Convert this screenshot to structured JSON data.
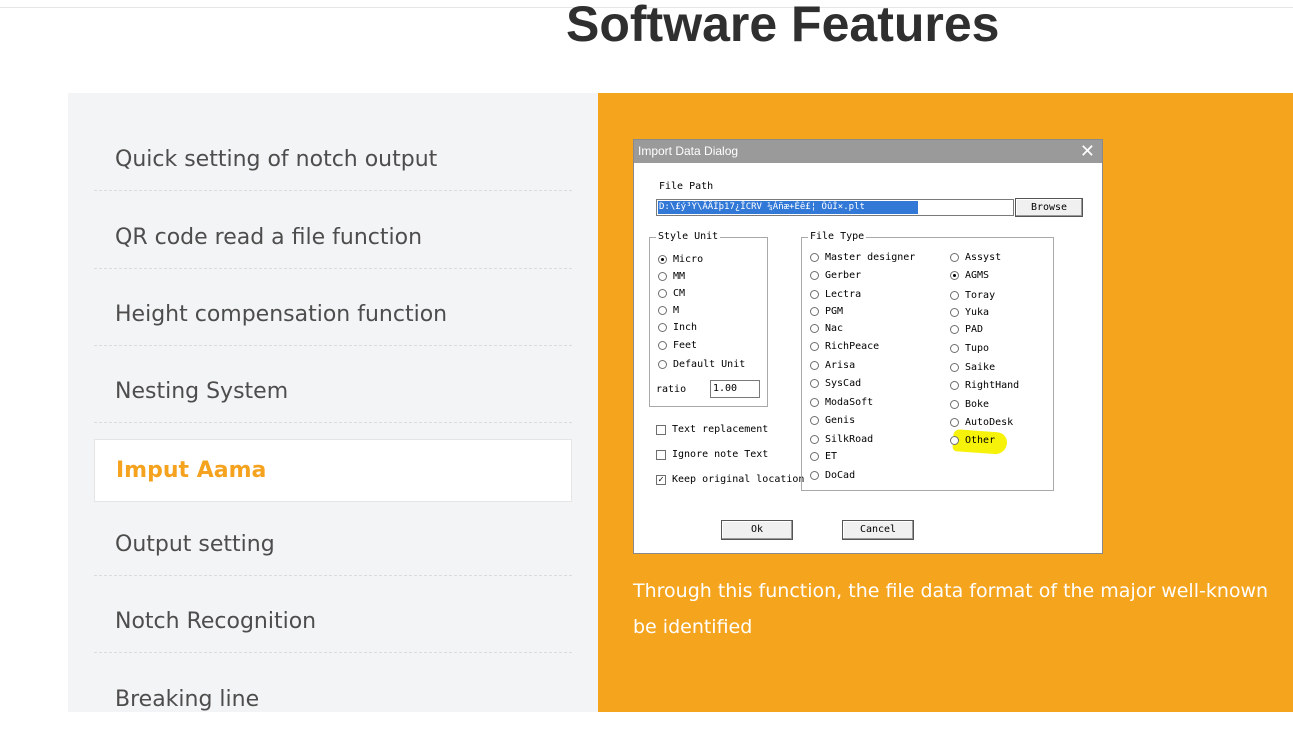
{
  "page_title": "Software Features",
  "menu": [
    {
      "label": "Quick setting of notch output",
      "active": false
    },
    {
      "label": "QR code read a file function",
      "active": false
    },
    {
      "label": "Height compensation function",
      "active": false
    },
    {
      "label": "Nesting System",
      "active": false
    },
    {
      "label": "Imput Aama",
      "active": true
    },
    {
      "label": "Output setting",
      "active": false
    },
    {
      "label": "Notch Recognition",
      "active": false
    },
    {
      "label": "Breaking line",
      "active": false
    }
  ],
  "dialog": {
    "title": "Import Data Dialog",
    "close_glyph": "✕",
    "file_path_label": "File Path",
    "file_path_value": "D:\\£ý³Ý\\ÄÄÍþ17¿ÎCRV      ¼Àñæ+Èê£¦      ÕûÌ×.plt",
    "browse_label": "Browse",
    "style_unit_title": "Style Unit",
    "units": [
      "Micro",
      "MM",
      "CM",
      "M",
      "Inch",
      "Feet",
      "Default Unit"
    ],
    "selected_unit": "Micro",
    "ratio_label": "ratio",
    "ratio_value": "1.00",
    "options": [
      {
        "label": "Text replacement",
        "checked": false
      },
      {
        "label": "Ignore note Text",
        "checked": false
      },
      {
        "label": "Keep original location",
        "checked": true
      }
    ],
    "file_type_title": "File Type",
    "file_types_col1": [
      "Master designer",
      "Gerber",
      "Lectra",
      "PGM",
      "Nac",
      "RichPeace",
      "Arisa",
      "SysCad",
      "ModaSoft",
      "Genis",
      "SilkRoad",
      "ET",
      "DoCad"
    ],
    "file_types_col2": [
      "Assyst",
      "AGMS",
      "Toray",
      "Yuka",
      "PAD",
      "Tupo",
      "Saike",
      "RightHand",
      "Boke",
      "AutoDesk",
      "Other"
    ],
    "selected_file_type": "AGMS",
    "highlight_color": "#f7f20a",
    "ok_label": "Ok",
    "cancel_label": "Cancel"
  },
  "description": {
    "line1": "Through this function, the file data format of the major well-known",
    "line2": "be identified"
  },
  "colors": {
    "accent": "#f5a31f",
    "panel_orange": "#f5a41e",
    "left_panel_bg": "#f3f4f5"
  }
}
